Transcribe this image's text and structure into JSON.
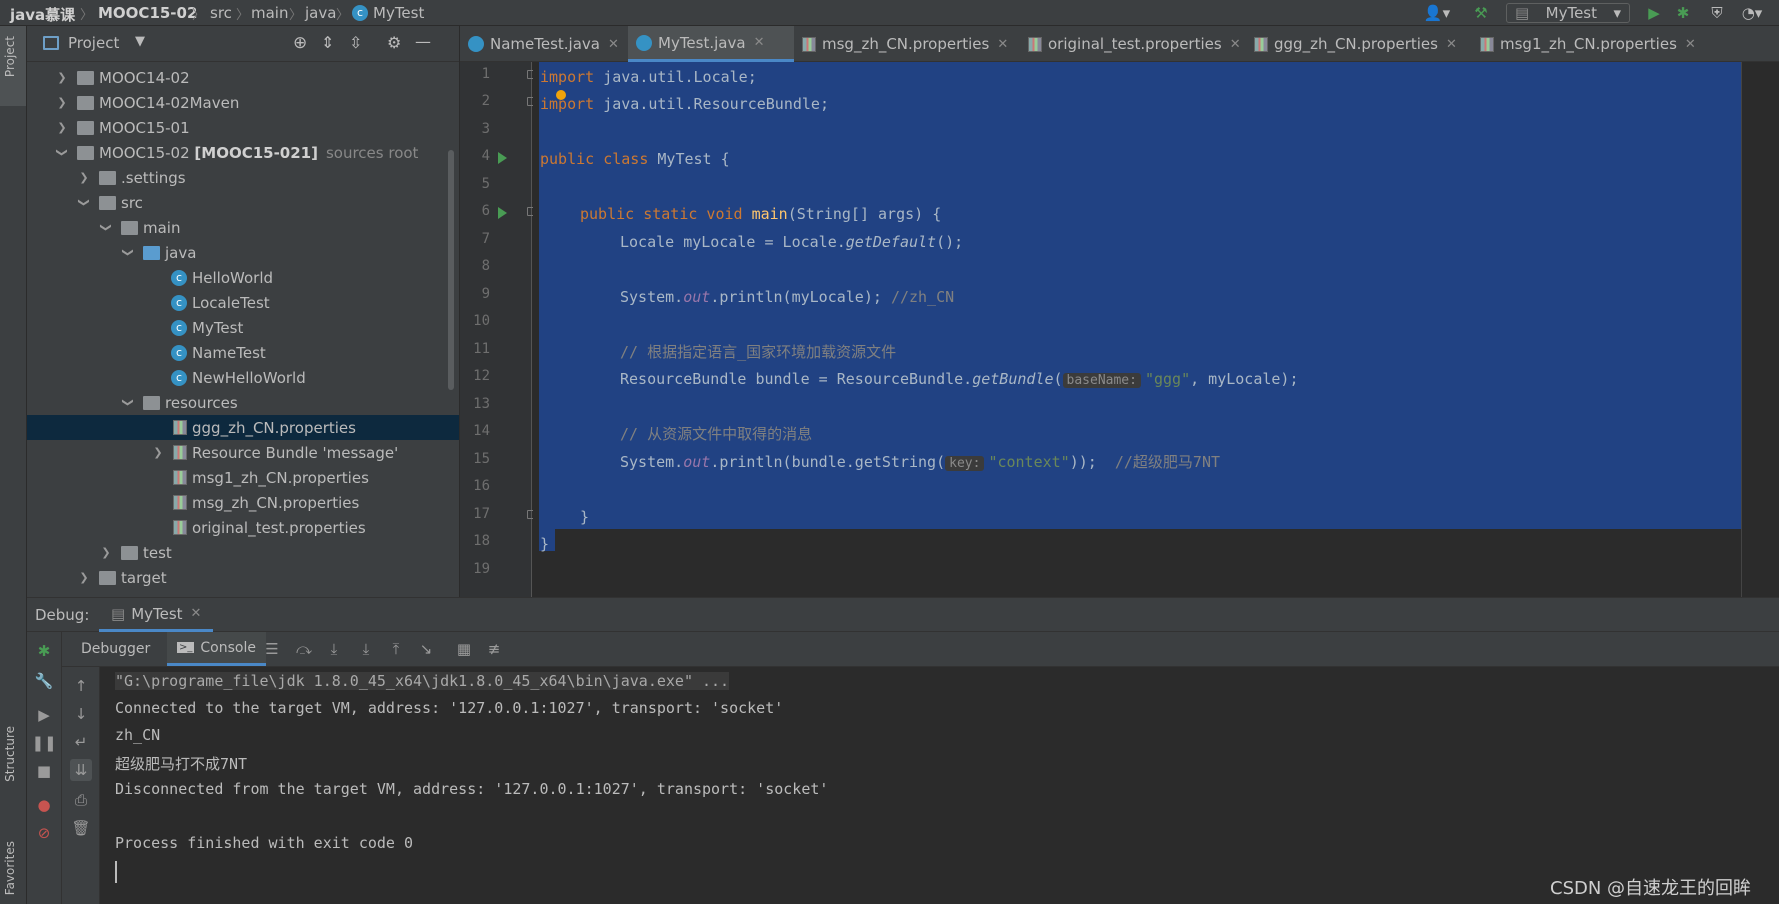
{
  "navbar": {
    "crumbs": [
      "java慕课",
      "MOOC15-02",
      "src",
      "main",
      "java",
      "MyTest"
    ],
    "run_config": "MyTest"
  },
  "side_tabs": {
    "project": "Project",
    "structure": "Structure",
    "favorites": "Favorites"
  },
  "project_panel": {
    "title": "Project",
    "items": [
      {
        "label": "MOOC14-02",
        "extra": "",
        "icon": "folder-icon",
        "expanded": false
      },
      {
        "label": "MOOC14-02Maven",
        "extra": "",
        "icon": "folder-icon",
        "expanded": false
      },
      {
        "label": "MOOC15-01",
        "extra": "",
        "icon": "folder-icon",
        "expanded": false
      },
      {
        "label": "MOOC15-02",
        "bold": "[MOOC15-021]",
        "extra": "sources root",
        "icon": "module-folder-icon",
        "expanded": true
      },
      {
        "label": ".settings",
        "extra": "",
        "icon": "folder-icon",
        "expanded": false
      },
      {
        "label": "src",
        "extra": "",
        "icon": "folder-icon",
        "expanded": true
      },
      {
        "label": "main",
        "extra": "",
        "icon": "folder-icon",
        "expanded": true
      },
      {
        "label": "java",
        "extra": "",
        "icon": "source-folder-icon",
        "expanded": true
      },
      {
        "label": "HelloWorld",
        "extra": "",
        "icon": "class-icon"
      },
      {
        "label": "LocaleTest",
        "extra": "",
        "icon": "class-icon"
      },
      {
        "label": "MyTest",
        "extra": "",
        "icon": "class-icon"
      },
      {
        "label": "NameTest",
        "extra": "",
        "icon": "class-icon"
      },
      {
        "label": "NewHelloWorld",
        "extra": "",
        "icon": "class-icon"
      },
      {
        "label": "resources",
        "extra": "",
        "icon": "resources-folder-icon",
        "expanded": true
      },
      {
        "label": "ggg_zh_CN.properties",
        "extra": "",
        "icon": "properties-file-icon",
        "selected": true
      },
      {
        "label": "Resource Bundle 'message'",
        "extra": "",
        "icon": "resource-bundle-icon",
        "expanded": false
      },
      {
        "label": "msg1_zh_CN.properties",
        "extra": "",
        "icon": "properties-file-icon"
      },
      {
        "label": "msg_zh_CN.properties",
        "extra": "",
        "icon": "properties-file-icon"
      },
      {
        "label": "original_test.properties",
        "extra": "",
        "icon": "properties-file-icon"
      },
      {
        "label": "test",
        "extra": "",
        "icon": "folder-icon",
        "expanded": false
      },
      {
        "label": "target",
        "extra": "",
        "icon": "folder-icon",
        "expanded": false
      }
    ]
  },
  "editor_tabs": [
    {
      "label": "NameTest.java",
      "icon": "class-icon",
      "active": false
    },
    {
      "label": "MyTest.java",
      "icon": "class-icon",
      "active": true
    },
    {
      "label": "msg_zh_CN.properties",
      "icon": "properties-file-icon",
      "active": false
    },
    {
      "label": "original_test.properties",
      "icon": "properties-file-icon",
      "active": false
    },
    {
      "label": "ggg_zh_CN.properties",
      "icon": "properties-file-icon",
      "active": false
    },
    {
      "label": "msg1_zh_CN.properties",
      "icon": "properties-file-icon",
      "active": false
    }
  ],
  "code": {
    "line_numbers": [
      "1",
      "2",
      "3",
      "4",
      "5",
      "6",
      "7",
      "8",
      "9",
      "10",
      "11",
      "12",
      "13",
      "14",
      "15",
      "16",
      "17",
      "18",
      "19"
    ],
    "l1_kw": "import",
    "l1_rest": " java.util.Locale;",
    "l2_kw": "import",
    "l2_rest": " java.util.ResourceBundle;",
    "l4_kw": "public class",
    "l4_rest": " MyTest {",
    "l6_kw": "public static void",
    "l6_fn": "main",
    "l6_rest": "(String[] args) {",
    "l7_a": "Locale myLocale = Locale.",
    "l7_m": "getDefault",
    "l7_b": "();",
    "l9_a": "System.",
    "l9_f": "out",
    "l9_b": ".println(myLocale); ",
    "l9_c": "//zh_CN",
    "l11_c": "// 根据指定语言_国家环境加载资源文件",
    "l12_a": "ResourceBundle bundle = ResourceBundle.",
    "l12_m": "getBundle",
    "l12_b": "(",
    "l12_hint": "baseName:",
    "l12_s": "\"ggg\"",
    "l12_c": ", myLocale);",
    "l14_c": "// 从资源文件中取得的消息",
    "l15_a": "System.",
    "l15_f": "out",
    "l15_b": ".println(bundle.getString(",
    "l15_hint": "key:",
    "l15_s": "\"context\"",
    "l15_c": "));  ",
    "l15_cm": "//超级肥马7NT",
    "l17": "}",
    "l18": "}"
  },
  "debug": {
    "label": "Debug:",
    "session_tab": "MyTest",
    "debugger_tab": "Debugger",
    "console_tab": "Console",
    "console_lines": [
      "\"G:\\programe_file\\jdk 1.8.0_45_x64\\jdk1.8.0_45_x64\\bin\\java.exe\" ...",
      "Connected to the target VM, address: '127.0.0.1:1027', transport: 'socket'",
      "zh_CN",
      "超级肥马打不成7NT",
      "Disconnected from the target VM, address: '127.0.0.1:1027', transport: 'socket'",
      "",
      "Process finished with exit code 0"
    ]
  },
  "watermark": "CSDN @自速龙王的回眸",
  "colors": {
    "selection": "#214283",
    "keyword": "#cc7832",
    "string": "#6a8759",
    "accent": "#4a88c7",
    "run": "#499c54"
  }
}
